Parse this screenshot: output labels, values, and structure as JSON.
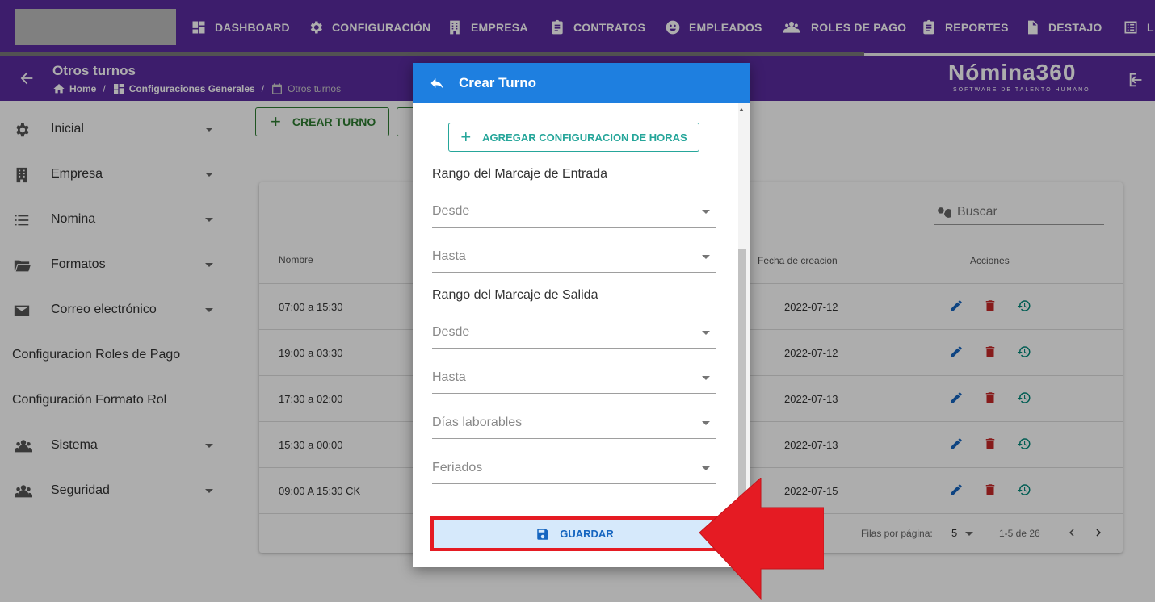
{
  "topnav": {
    "items": [
      {
        "label": "DASHBOARD",
        "icon": "dashboard-icon"
      },
      {
        "label": "CONFIGURACIÓN",
        "icon": "gear-icon"
      },
      {
        "label": "EMPRESA",
        "icon": "building-icon"
      },
      {
        "label": "CONTRATOS",
        "icon": "clipboard-icon"
      },
      {
        "label": "EMPLEADOS",
        "icon": "face-icon"
      },
      {
        "label": "ROLES DE PAGO",
        "icon": "people-icon"
      },
      {
        "label": "REPORTES",
        "icon": "clipboard-icon"
      },
      {
        "label": "DESTAJO",
        "icon": "document-icon"
      },
      {
        "label": "L",
        "icon": "list-icon"
      }
    ]
  },
  "subheader": {
    "title": "Otros turnos",
    "breadcrumb": [
      "Home",
      "Configuraciones Generales",
      "Otros turnos"
    ],
    "brand": "Nómina360",
    "brand_sub": "SOFTWARE DE TALENTO HUMANO"
  },
  "sidebar": {
    "items": [
      {
        "label": "Inicial",
        "icon": "gear-icon",
        "expandable": true
      },
      {
        "label": "Empresa",
        "icon": "building-icon",
        "expandable": true
      },
      {
        "label": "Nomina",
        "icon": "list-icon",
        "expandable": true
      },
      {
        "label": "Formatos",
        "icon": "folder-icon",
        "expandable": true
      },
      {
        "label": "Correo electrónico",
        "icon": "mail-icon",
        "expandable": true
      },
      {
        "label": "Configuracion Roles de Pago",
        "icon": "",
        "expandable": false
      },
      {
        "label": "Configuración Formato Rol",
        "icon": "",
        "expandable": false
      },
      {
        "label": "Sistema",
        "icon": "people-icon",
        "expandable": true
      },
      {
        "label": "Seguridad",
        "icon": "people-icon",
        "expandable": true
      }
    ]
  },
  "main": {
    "create_button": "CREAR TURNO",
    "search_placeholder": "Buscar",
    "columns": {
      "name": "Nombre",
      "date": "Fecha de creacion",
      "actions": "Acciones"
    },
    "rows": [
      {
        "name": "07:00 a 15:30",
        "date": "2022-07-12"
      },
      {
        "name": "19:00 a 03:30",
        "date": "2022-07-12"
      },
      {
        "name": "17:30 a 02:00",
        "date": "2022-07-13"
      },
      {
        "name": "15:30 a 00:00",
        "date": "2022-07-13"
      },
      {
        "name": "09:00 A 15:30 CK",
        "date": "2022-07-15"
      }
    ],
    "footer": {
      "rows_per_page_label": "Filas por página:",
      "rows_per_page": "5",
      "range": "1-5 de 26"
    }
  },
  "dialog": {
    "title": "Crear Turno",
    "add_button": "AGREGAR CONFIGURACION DE HORAS",
    "entrada_label": "Rango del Marcaje de Entrada",
    "salida_label": "Rango del Marcaje de Salida",
    "entrada_desde": "Desde",
    "entrada_hasta": "Hasta",
    "salida_desde": "Desde",
    "salida_hasta": "Hasta",
    "dias": "Días laborables",
    "feriados": "Feriados",
    "save_button": "GUARDAR"
  },
  "colors": {
    "primary": "#5a2ca0",
    "dialog_header": "#1e7fe0",
    "accent_green": "#2e7d32",
    "highlight_red": "#e51b23"
  }
}
